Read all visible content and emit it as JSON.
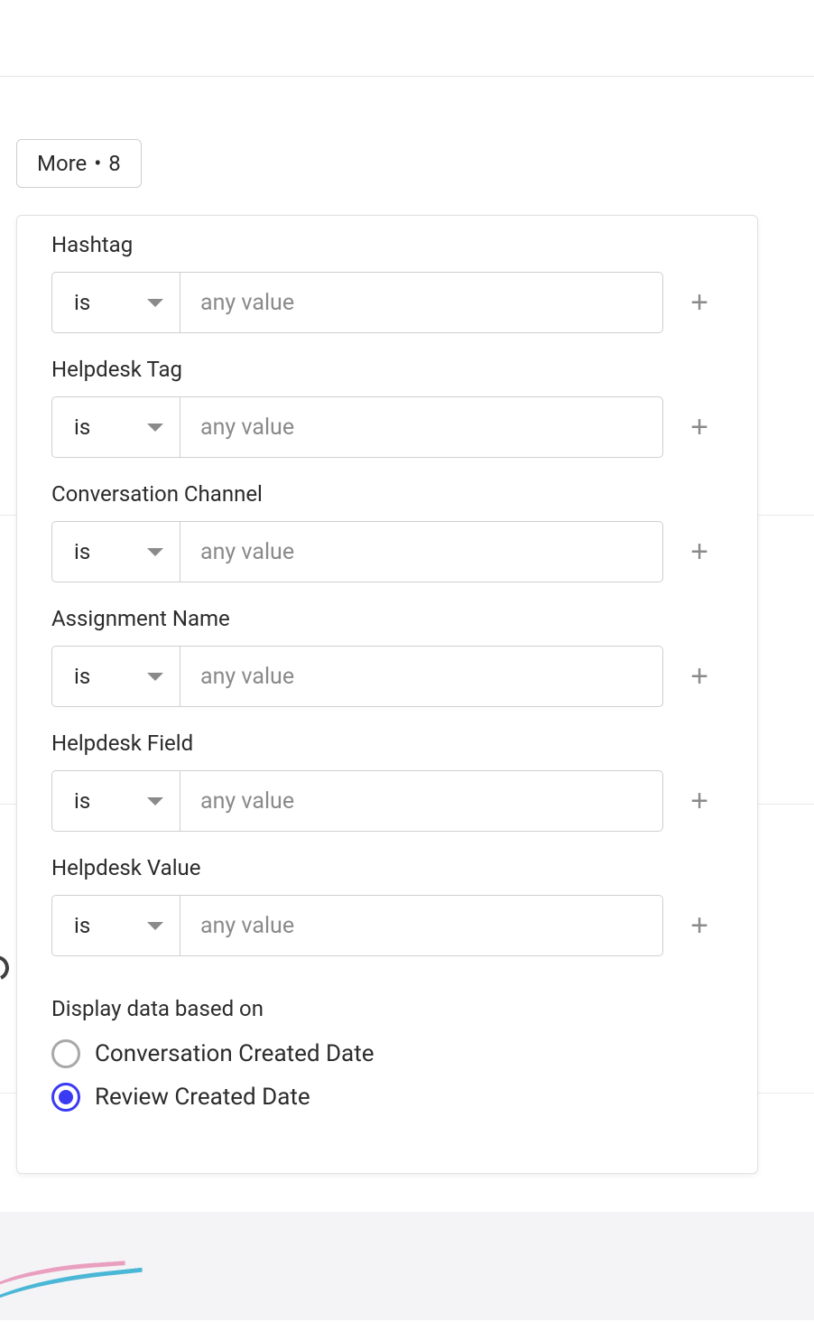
{
  "moreButton": {
    "label": "More",
    "separator": "•",
    "count": "8"
  },
  "filters": [
    {
      "label": "Hashtag",
      "operator": "is",
      "placeholder": "any value"
    },
    {
      "label": "Helpdesk Tag",
      "operator": "is",
      "placeholder": "any value"
    },
    {
      "label": "Conversation Channel",
      "operator": "is",
      "placeholder": "any value"
    },
    {
      "label": "Assignment Name",
      "operator": "is",
      "placeholder": "any value"
    },
    {
      "label": "Helpdesk Field",
      "operator": "is",
      "placeholder": "any value"
    },
    {
      "label": "Helpdesk Value",
      "operator": "is",
      "placeholder": "any value"
    }
  ],
  "radioSection": {
    "label": "Display data based on",
    "options": [
      {
        "label": "Conversation Created Date",
        "selected": false
      },
      {
        "label": "Review Created Date",
        "selected": true
      }
    ]
  }
}
